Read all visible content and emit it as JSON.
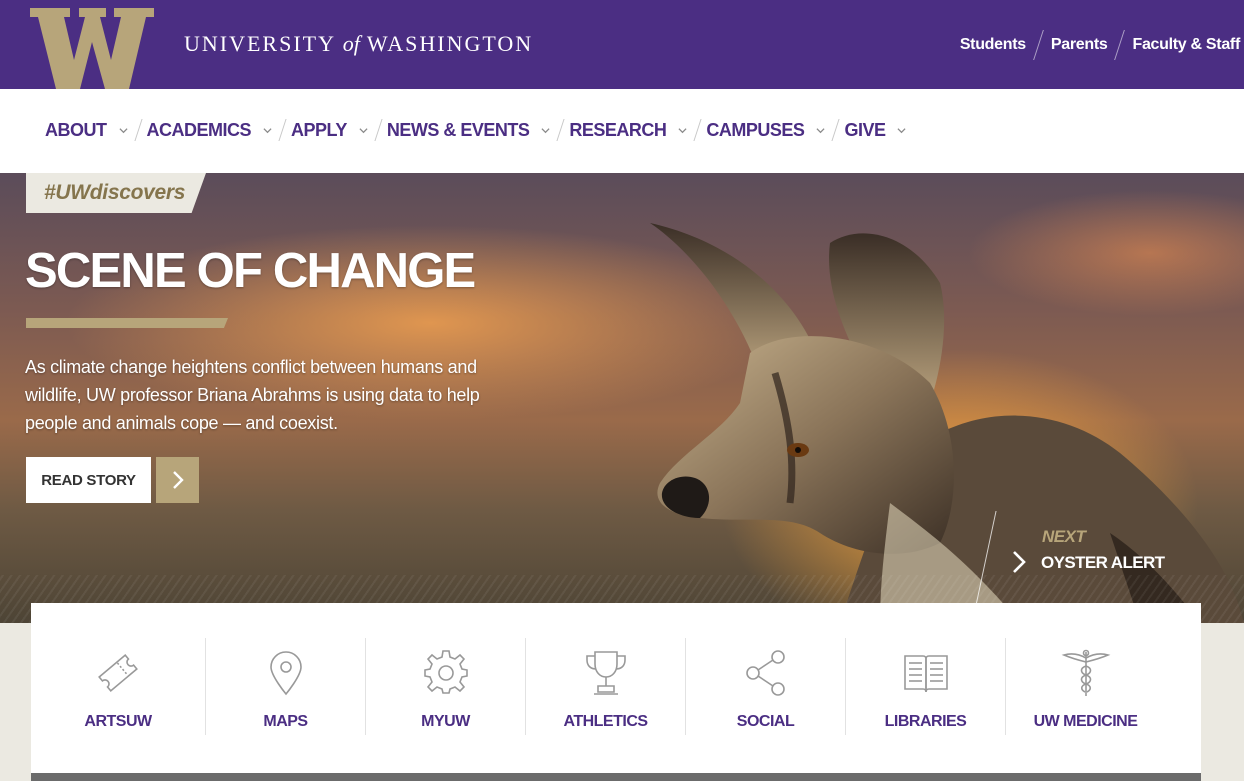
{
  "header": {
    "logo_letter": "W",
    "wordmark_pre": "UNIVERSITY",
    "wordmark_of": "of",
    "wordmark_post": "WASHINGTON",
    "audience_links": [
      "Students",
      "Parents",
      "Faculty & Staff"
    ]
  },
  "nav": {
    "items": [
      "ABOUT",
      "ACADEMICS",
      "APPLY",
      "NEWS & EVENTS",
      "RESEARCH",
      "CAMPUSES",
      "GIVE"
    ]
  },
  "hero": {
    "tag": "#UWdiscovers",
    "title": "SCENE OF CHANGE",
    "text": "As climate change heightens conflict between humans and wildlife, UW professor Briana Abrahms is using data to help people and animals cope — and coexist.",
    "read_label": "READ STORY",
    "next_label": "NEXT",
    "next_title": "OYSTER ALERT"
  },
  "quick_links": [
    {
      "label": "ARTSUW",
      "icon": "ticket-icon"
    },
    {
      "label": "MAPS",
      "icon": "map-pin-icon"
    },
    {
      "label": "MYUW",
      "icon": "gear-icon"
    },
    {
      "label": "ATHLETICS",
      "icon": "trophy-icon"
    },
    {
      "label": "SOCIAL",
      "icon": "share-icon"
    },
    {
      "label": "LIBRARIES",
      "icon": "book-icon"
    },
    {
      "label": "UW MEDICINE",
      "icon": "caduceus-icon"
    }
  ],
  "colors": {
    "purple": "#4b2e83",
    "gold": "#b7a57a",
    "gold_dark": "#85754d",
    "background": "#ebe9e1"
  }
}
